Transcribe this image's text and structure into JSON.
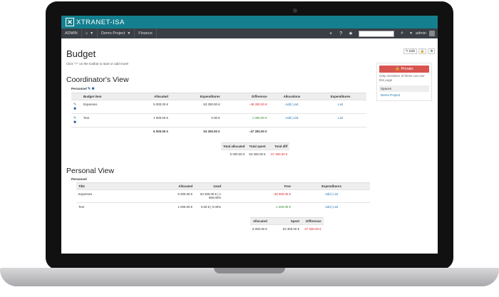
{
  "app": {
    "brand": "XTRANET-ISA"
  },
  "nav": {
    "admin_label": "ADMIN",
    "home_icon": "home-icon",
    "project": "Demo Project",
    "section": "Finance",
    "user": "admin"
  },
  "page": {
    "title": "Budget",
    "hint": "Click \"+\" on the toolbar to start or add more!"
  },
  "toolbar": {
    "edit_label": "✎ Edit",
    "lock_label": "🔒",
    "settings_label": "⚙"
  },
  "side": {
    "private_label": "🔒 Private",
    "note": "Only members of these can see this page",
    "spaces_header": "Spaces",
    "space_item": "Demo Project"
  },
  "coordinator": {
    "title": "Coordinator's View",
    "section_label": "Personnel",
    "headers": [
      "Budget item",
      "Allocated",
      "Expenditures",
      "Difference",
      "Allocations",
      "Expenditures"
    ],
    "rows": [
      {
        "item": "Expenses",
        "allocated": "5 000.00 €",
        "expenditures": "53 300.00 €",
        "difference": "-48 300.00 €",
        "allocations": "Add | List",
        "exp_link": "List"
      },
      {
        "item": "Test",
        "allocated": "1 000.00 €",
        "expenditures": "0.00 €",
        "difference": "1 000.00 €",
        "allocations": "Add | List",
        "exp_link": "List"
      }
    ],
    "total_row": {
      "allocated": "6 000.00 €",
      "expenditures": "53 300.00 €",
      "difference": "-47 300.00 €"
    },
    "summary_headers": [
      "Total allocated",
      "Total spent",
      "Total diff"
    ],
    "summary_values": [
      "6 000.00 €",
      "53 300.00 €",
      "-47 300.00 €"
    ]
  },
  "personal": {
    "title": "Personal View",
    "section_label": "Personnel",
    "headers": [
      "Title",
      "Allocated",
      "Used",
      "Free",
      "Expenditures"
    ],
    "rows": [
      {
        "title": "Expenses",
        "allocated": "5 000.00 €",
        "used": "53 300.00 € | 1 066.00%",
        "free": "-48 300.00 €",
        "exp": "Add | List"
      },
      {
        "title": "Test",
        "allocated": "1 000.00 €",
        "used": "0.00 € | 0.00%",
        "free": "1 000.00 €",
        "exp": "Add | List"
      }
    ],
    "summary_headers": [
      "Allocated",
      "Spent",
      "Difference"
    ],
    "summary_values": [
      "6 000.00 €",
      "53 300.00 €",
      "-47 300.00 €"
    ]
  }
}
